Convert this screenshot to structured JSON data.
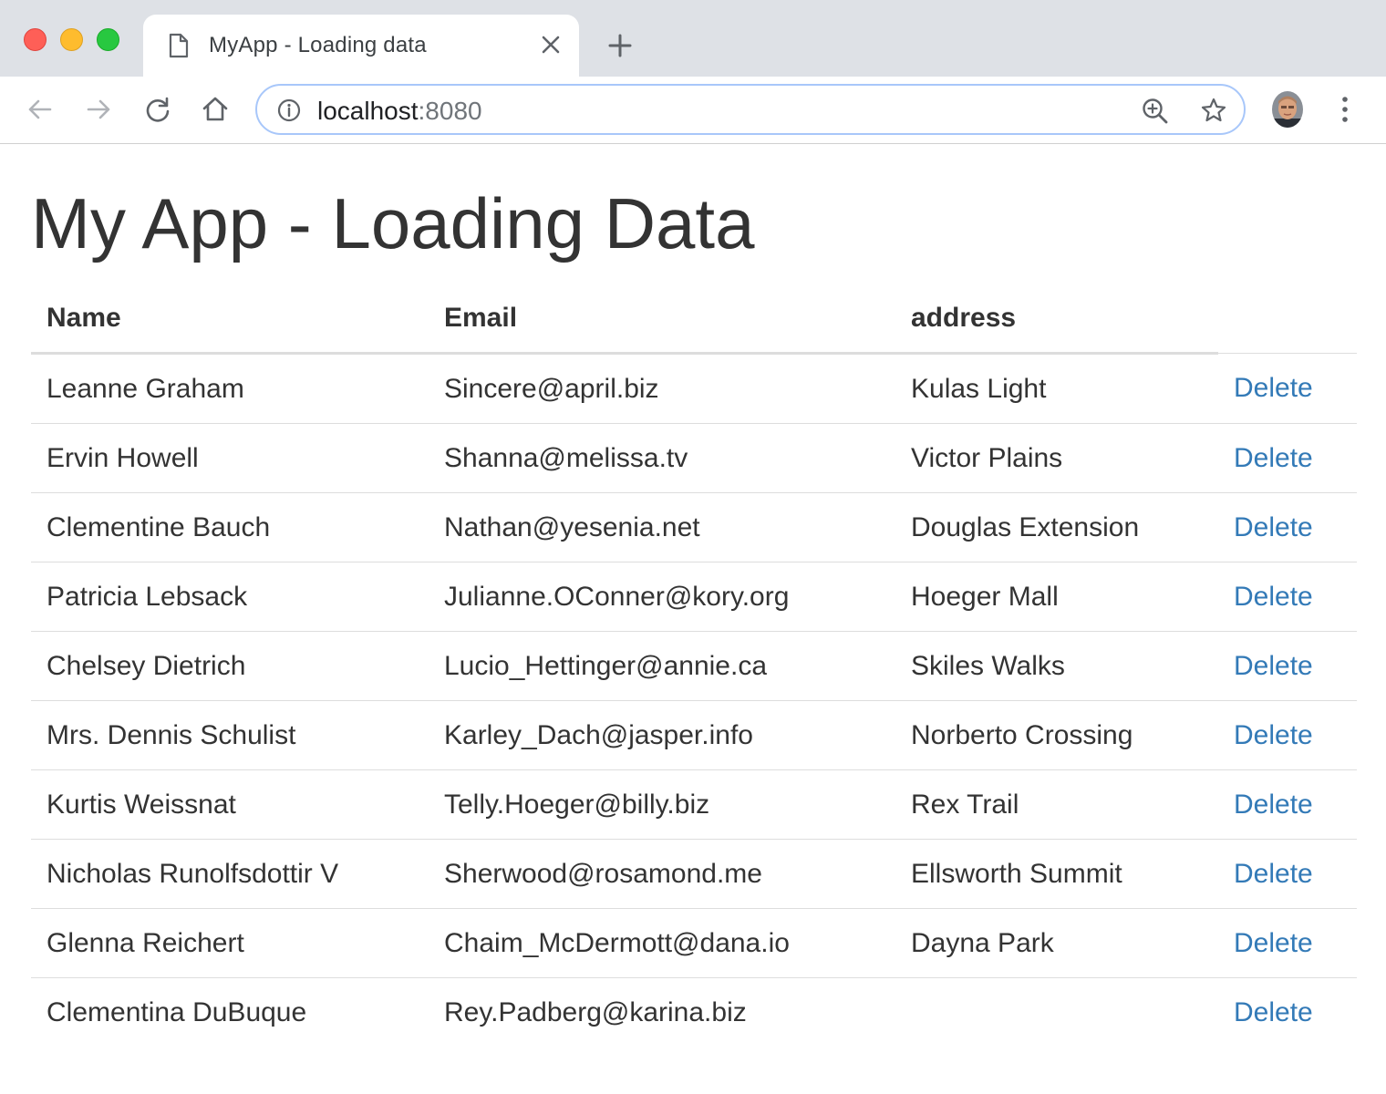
{
  "window": {
    "tab": {
      "title": "MyApp - Loading data"
    },
    "address_bar": {
      "host": "localhost",
      "port": ":8080"
    }
  },
  "page": {
    "title": "My App - Loading Data",
    "table": {
      "headers": [
        "Name",
        "Email",
        "address",
        ""
      ],
      "rows": [
        {
          "name": "Leanne Graham",
          "email": "Sincere@april.biz",
          "address": "Kulas Light",
          "action": "Delete"
        },
        {
          "name": "Ervin Howell",
          "email": "Shanna@melissa.tv",
          "address": "Victor Plains",
          "action": "Delete"
        },
        {
          "name": "Clementine Bauch",
          "email": "Nathan@yesenia.net",
          "address": "Douglas Extension",
          "action": "Delete"
        },
        {
          "name": "Patricia Lebsack",
          "email": "Julianne.OConner@kory.org",
          "address": "Hoeger Mall",
          "action": "Delete"
        },
        {
          "name": "Chelsey Dietrich",
          "email": "Lucio_Hettinger@annie.ca",
          "address": "Skiles Walks",
          "action": "Delete"
        },
        {
          "name": "Mrs. Dennis Schulist",
          "email": "Karley_Dach@jasper.info",
          "address": "Norberto Crossing",
          "action": "Delete"
        },
        {
          "name": "Kurtis Weissnat",
          "email": "Telly.Hoeger@billy.biz",
          "address": "Rex Trail",
          "action": "Delete"
        },
        {
          "name": "Nicholas Runolfsdottir V",
          "email": "Sherwood@rosamond.me",
          "address": "Ellsworth Summit",
          "action": "Delete"
        },
        {
          "name": "Glenna Reichert",
          "email": "Chaim_McDermott@dana.io",
          "address": "Dayna Park",
          "action": "Delete"
        },
        {
          "name": "Clementina DuBuque",
          "email": "Rey.Padberg@karina.biz",
          "address": "",
          "action": "Delete"
        }
      ]
    }
  },
  "colors": {
    "link": "#337ab7",
    "text": "#333333",
    "tabstrip": "#dee1e6",
    "omnibox_focus": "#a8c7fa"
  },
  "icons": [
    "page-icon",
    "close-icon",
    "plus-icon",
    "back-arrow-icon",
    "forward-arrow-icon",
    "reload-icon",
    "home-icon",
    "info-icon",
    "zoom-icon",
    "star-icon",
    "kebab-menu-icon"
  ]
}
